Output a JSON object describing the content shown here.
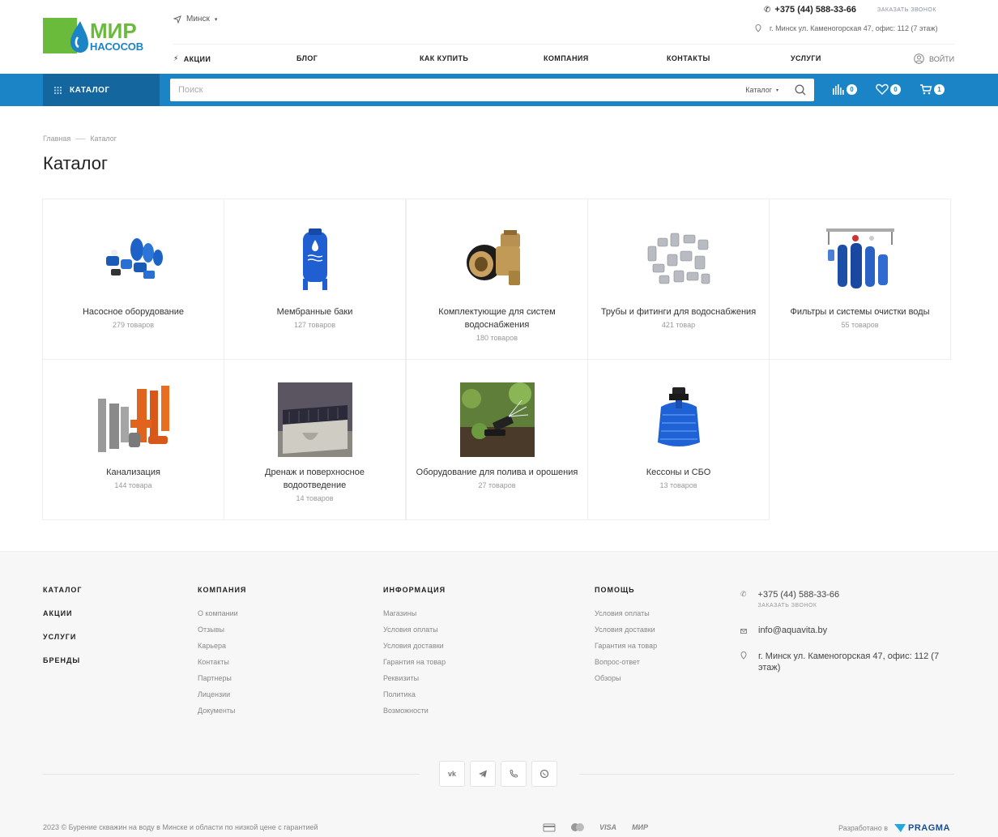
{
  "header": {
    "logo_line1": "МИР",
    "logo_line2": "НАСОСОВ",
    "city": "Минск",
    "phone": "+375 (44) 588-33-66",
    "callback": "Заказать звонок",
    "address": "г. Минск ул. Каменогорская 47, офис: 112 (7 этаж)",
    "nav": [
      "Акции",
      "Блог",
      "Как купить",
      "Компания",
      "Контакты",
      "Услуги"
    ],
    "login": "Войти"
  },
  "searchbar": {
    "catalog_button": "КАТАЛОГ",
    "placeholder": "Поиск",
    "scope": "Каталог",
    "compare_count": "0",
    "favorites_count": "0",
    "cart_count": "1"
  },
  "breadcrumbs": [
    "Главная",
    "Каталог"
  ],
  "page_title": "Каталог",
  "categories": [
    {
      "name": "Насосное оборудование",
      "count": "279 товаров",
      "icon": "pumps-image"
    },
    {
      "name": "Мембранные баки",
      "count": "127 товаров",
      "icon": "membrane-tank-image"
    },
    {
      "name": "Комплектующие для систем водоснабжения",
      "count": "180 товаров",
      "icon": "brass-fitting-image"
    },
    {
      "name": "Трубы и фитинги для водоснабжения",
      "count": "421 товар",
      "icon": "pipe-fittings-image"
    },
    {
      "name": "Фильтры и системы очистки воды",
      "count": "55 товаров",
      "icon": "water-filters-image"
    },
    {
      "name": "Канализация",
      "count": "144 товара",
      "icon": "sewer-pipes-image"
    },
    {
      "name": "Дренаж и поверхносное водоотведение",
      "count": "14 товаров",
      "icon": "drainage-channel-image"
    },
    {
      "name": "Оборудование для полива и орошения",
      "count": "27 товаров",
      "icon": "sprinkler-image"
    },
    {
      "name": "Кессоны и СБО",
      "count": "13 товаров",
      "icon": "caisson-image"
    }
  ],
  "footer": {
    "main_links": [
      "Каталог",
      "Акции",
      "Услуги",
      "Бренды"
    ],
    "company": {
      "title": "Компания",
      "links": [
        "О компании",
        "Отзывы",
        "Карьера",
        "Контакты",
        "Партнеры",
        "Лицензии",
        "Документы"
      ]
    },
    "info": {
      "title": "Информация",
      "links": [
        "Магазины",
        "Условия оплаты",
        "Условия доставки",
        "Гарантия на товар",
        "Реквизиты",
        "Политика",
        "Возможности"
      ]
    },
    "help": {
      "title": "Помощь",
      "links": [
        "Условия оплаты",
        "Условия доставки",
        "Гарантия на товар",
        "Вопрос-ответ",
        "Обзоры"
      ]
    },
    "phone": "+375 (44) 588-33-66",
    "callback": "Заказать звонок",
    "email": "info@aquavita.by",
    "address": "г. Минск ул. Каменогорская 47, офис: 112 (7 этаж)",
    "social": [
      "vk-icon",
      "telegram-icon",
      "viber-icon",
      "whatsapp-icon"
    ],
    "copyright": "2023 © Бурение скважин на воду в Минске и области по низкой цене с гарантией",
    "payments": [
      "VISA",
      "МИР"
    ],
    "developed_by": "Разработано в",
    "developer": "PRAGMA"
  },
  "colors": {
    "brand_blue": "#1a84c7",
    "catalog_dark": "#13679e",
    "logo_green": "#6aba3c"
  }
}
